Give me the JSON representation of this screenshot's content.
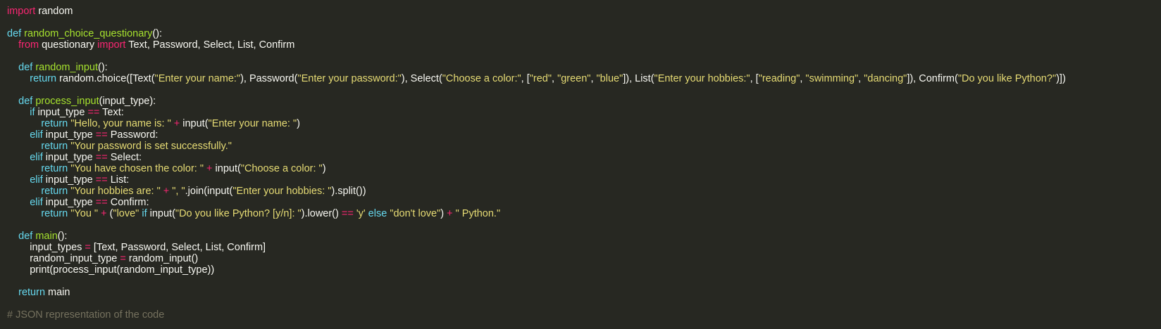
{
  "editor": {
    "lines": [
      [
        {
          "t": "import",
          "c": "kw"
        },
        {
          "t": " random",
          "c": "plain"
        }
      ],
      [],
      [
        {
          "t": "def",
          "c": "kw2"
        },
        {
          "t": " ",
          "c": "plain"
        },
        {
          "t": "random_choice_questionary",
          "c": "fn"
        },
        {
          "t": "():",
          "c": "plain"
        }
      ],
      [
        {
          "t": "    ",
          "c": "plain"
        },
        {
          "t": "from",
          "c": "kw"
        },
        {
          "t": " questionary ",
          "c": "plain"
        },
        {
          "t": "import",
          "c": "kw"
        },
        {
          "t": " Text, Password, Select, List, Confirm",
          "c": "plain"
        }
      ],
      [],
      [
        {
          "t": "    ",
          "c": "plain"
        },
        {
          "t": "def",
          "c": "kw2"
        },
        {
          "t": " ",
          "c": "plain"
        },
        {
          "t": "random_input",
          "c": "fn"
        },
        {
          "t": "():",
          "c": "plain"
        }
      ],
      [
        {
          "t": "        ",
          "c": "plain"
        },
        {
          "t": "return",
          "c": "kw2"
        },
        {
          "t": " random.choice([Text(",
          "c": "plain"
        },
        {
          "t": "\"Enter your name:\"",
          "c": "str"
        },
        {
          "t": "), Password(",
          "c": "plain"
        },
        {
          "t": "\"Enter your password:\"",
          "c": "str"
        },
        {
          "t": "), Select(",
          "c": "plain"
        },
        {
          "t": "\"Choose a color:\"",
          "c": "str"
        },
        {
          "t": ", [",
          "c": "plain"
        },
        {
          "t": "\"red\"",
          "c": "str"
        },
        {
          "t": ", ",
          "c": "plain"
        },
        {
          "t": "\"green\"",
          "c": "str"
        },
        {
          "t": ", ",
          "c": "plain"
        },
        {
          "t": "\"blue\"",
          "c": "str"
        },
        {
          "t": "]), List(",
          "c": "plain"
        },
        {
          "t": "\"Enter your hobbies:\"",
          "c": "str"
        },
        {
          "t": ", [",
          "c": "plain"
        },
        {
          "t": "\"reading\"",
          "c": "str"
        },
        {
          "t": ", ",
          "c": "plain"
        },
        {
          "t": "\"swimming\"",
          "c": "str"
        },
        {
          "t": ", ",
          "c": "plain"
        },
        {
          "t": "\"dancing\"",
          "c": "str"
        },
        {
          "t": "]), Confirm(",
          "c": "plain"
        },
        {
          "t": "\"Do you like Python?\"",
          "c": "str"
        },
        {
          "t": ")])",
          "c": "plain"
        }
      ],
      [],
      [
        {
          "t": "    ",
          "c": "plain"
        },
        {
          "t": "def",
          "c": "kw2"
        },
        {
          "t": " ",
          "c": "plain"
        },
        {
          "t": "process_input",
          "c": "fn"
        },
        {
          "t": "(input_type):",
          "c": "plain"
        }
      ],
      [
        {
          "t": "        ",
          "c": "plain"
        },
        {
          "t": "if",
          "c": "kw2"
        },
        {
          "t": " input_type ",
          "c": "plain"
        },
        {
          "t": "==",
          "c": "op"
        },
        {
          "t": " Text:",
          "c": "plain"
        }
      ],
      [
        {
          "t": "            ",
          "c": "plain"
        },
        {
          "t": "return",
          "c": "kw2"
        },
        {
          "t": " ",
          "c": "plain"
        },
        {
          "t": "\"Hello, your name is: \"",
          "c": "str"
        },
        {
          "t": " ",
          "c": "plain"
        },
        {
          "t": "+",
          "c": "op"
        },
        {
          "t": " input(",
          "c": "plain"
        },
        {
          "t": "\"Enter your name: \"",
          "c": "str"
        },
        {
          "t": ")",
          "c": "plain"
        }
      ],
      [
        {
          "t": "        ",
          "c": "plain"
        },
        {
          "t": "elif",
          "c": "kw2"
        },
        {
          "t": " input_type ",
          "c": "plain"
        },
        {
          "t": "==",
          "c": "op"
        },
        {
          "t": " Password:",
          "c": "plain"
        }
      ],
      [
        {
          "t": "            ",
          "c": "plain"
        },
        {
          "t": "return",
          "c": "kw2"
        },
        {
          "t": " ",
          "c": "plain"
        },
        {
          "t": "\"Your password is set successfully.\"",
          "c": "str"
        }
      ],
      [
        {
          "t": "        ",
          "c": "plain"
        },
        {
          "t": "elif",
          "c": "kw2"
        },
        {
          "t": " input_type ",
          "c": "plain"
        },
        {
          "t": "==",
          "c": "op"
        },
        {
          "t": " Select:",
          "c": "plain"
        }
      ],
      [
        {
          "t": "            ",
          "c": "plain"
        },
        {
          "t": "return",
          "c": "kw2"
        },
        {
          "t": " ",
          "c": "plain"
        },
        {
          "t": "\"You have chosen the color: \"",
          "c": "str"
        },
        {
          "t": " ",
          "c": "plain"
        },
        {
          "t": "+",
          "c": "op"
        },
        {
          "t": " input(",
          "c": "plain"
        },
        {
          "t": "\"Choose a color: \"",
          "c": "str"
        },
        {
          "t": ")",
          "c": "plain"
        }
      ],
      [
        {
          "t": "        ",
          "c": "plain"
        },
        {
          "t": "elif",
          "c": "kw2"
        },
        {
          "t": " input_type ",
          "c": "plain"
        },
        {
          "t": "==",
          "c": "op"
        },
        {
          "t": " List:",
          "c": "plain"
        }
      ],
      [
        {
          "t": "            ",
          "c": "plain"
        },
        {
          "t": "return",
          "c": "kw2"
        },
        {
          "t": " ",
          "c": "plain"
        },
        {
          "t": "\"Your hobbies are: \"",
          "c": "str"
        },
        {
          "t": " ",
          "c": "plain"
        },
        {
          "t": "+",
          "c": "op"
        },
        {
          "t": " ",
          "c": "plain"
        },
        {
          "t": "\", \"",
          "c": "str"
        },
        {
          "t": ".join(input(",
          "c": "plain"
        },
        {
          "t": "\"Enter your hobbies: \"",
          "c": "str"
        },
        {
          "t": ").split())",
          "c": "plain"
        }
      ],
      [
        {
          "t": "        ",
          "c": "plain"
        },
        {
          "t": "elif",
          "c": "kw2"
        },
        {
          "t": " input_type ",
          "c": "plain"
        },
        {
          "t": "==",
          "c": "op"
        },
        {
          "t": " Confirm:",
          "c": "plain"
        }
      ],
      [
        {
          "t": "            ",
          "c": "plain"
        },
        {
          "t": "return",
          "c": "kw2"
        },
        {
          "t": " ",
          "c": "plain"
        },
        {
          "t": "\"You \"",
          "c": "str"
        },
        {
          "t": " ",
          "c": "plain"
        },
        {
          "t": "+",
          "c": "op"
        },
        {
          "t": " (",
          "c": "plain"
        },
        {
          "t": "\"love\"",
          "c": "str"
        },
        {
          "t": " ",
          "c": "plain"
        },
        {
          "t": "if",
          "c": "kw2"
        },
        {
          "t": " input(",
          "c": "plain"
        },
        {
          "t": "\"Do you like Python? [y/n]: \"",
          "c": "str"
        },
        {
          "t": ").lower() ",
          "c": "plain"
        },
        {
          "t": "==",
          "c": "op"
        },
        {
          "t": " ",
          "c": "plain"
        },
        {
          "t": "'y'",
          "c": "str"
        },
        {
          "t": " ",
          "c": "plain"
        },
        {
          "t": "else",
          "c": "kw2"
        },
        {
          "t": " ",
          "c": "plain"
        },
        {
          "t": "\"don't love\"",
          "c": "str"
        },
        {
          "t": ") ",
          "c": "plain"
        },
        {
          "t": "+",
          "c": "op"
        },
        {
          "t": " ",
          "c": "plain"
        },
        {
          "t": "\" Python.\"",
          "c": "str"
        }
      ],
      [],
      [
        {
          "t": "    ",
          "c": "plain"
        },
        {
          "t": "def",
          "c": "kw2"
        },
        {
          "t": " ",
          "c": "plain"
        },
        {
          "t": "main",
          "c": "fn"
        },
        {
          "t": "():",
          "c": "plain"
        }
      ],
      [
        {
          "t": "        input_types ",
          "c": "plain"
        },
        {
          "t": "=",
          "c": "op"
        },
        {
          "t": " [Text, Password, Select, List, Confirm]",
          "c": "plain"
        }
      ],
      [
        {
          "t": "        random_input_type ",
          "c": "plain"
        },
        {
          "t": "=",
          "c": "op"
        },
        {
          "t": " random_input()",
          "c": "plain"
        }
      ],
      [
        {
          "t": "        print(process_input(random_input_type))",
          "c": "plain"
        }
      ],
      [],
      [
        {
          "t": "    ",
          "c": "plain"
        },
        {
          "t": "return",
          "c": "kw2"
        },
        {
          "t": " main",
          "c": "plain"
        }
      ],
      [],
      [
        {
          "t": "# JSON representation of the code",
          "c": "cmt"
        }
      ]
    ]
  }
}
